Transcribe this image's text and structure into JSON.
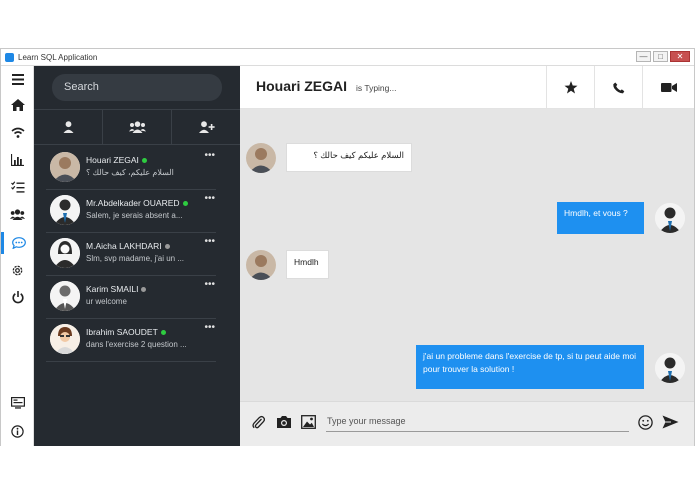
{
  "window": {
    "title": "Learn SQL Application",
    "controls": [
      "—",
      "□",
      "✕"
    ]
  },
  "rail": {
    "items": [
      "menu-icon",
      "home-icon",
      "wifi-icon",
      "stats-icon",
      "checklist-icon",
      "users-icon",
      "chat-icon",
      "settings-icon",
      "power-icon",
      "tv-icon",
      "info-icon"
    ],
    "active": "chat-icon"
  },
  "sidebar": {
    "search_placeholder": "Search",
    "tabs": [
      "person-icon",
      "group-icon",
      "add-person-icon"
    ],
    "contacts": [
      {
        "name": "Houari ZEGAI",
        "status": "online",
        "preview": "السلام عليكم، كيف حالك ؟",
        "more": "•••"
      },
      {
        "name": "Mr.Abdelkader OUARED",
        "status": "online",
        "preview": "Salem, je serais absent a...",
        "more": "•••"
      },
      {
        "name": "M.Aicha LAKHDARI",
        "status": "offline",
        "preview": "Slm, svp madame, j'ai un ...",
        "more": "•••"
      },
      {
        "name": "Karim SMAILI",
        "status": "offline",
        "preview": "ur welcome",
        "more": "•••"
      },
      {
        "name": "Ibrahim SAOUDET",
        "status": "online",
        "preview": "dans l'exercise 2 question ...",
        "more": "•••"
      }
    ]
  },
  "chat": {
    "name": "Houari ZEGAI",
    "status": "is Typing...",
    "header_actions": [
      "star-icon",
      "phone-icon",
      "video-icon"
    ],
    "messages": [
      {
        "side": "in",
        "text": "السلام عليكم كيف حالك ؟"
      },
      {
        "side": "out",
        "text": "Hmdlh, et vous ?"
      },
      {
        "side": "in",
        "text": "Hmdlh"
      },
      {
        "side": "out",
        "text": "j'ai un probleme dans l'exercise de tp, si tu peut aide moi pour trouver la solution !"
      }
    ]
  },
  "composer": {
    "placeholder": "Type your message",
    "icons": [
      "attach-icon",
      "camera-icon",
      "image-icon",
      "emoji-icon",
      "send-icon"
    ]
  },
  "colors": {
    "sidebar_bg": "#252a30",
    "accent": "#1e90f0",
    "online": "#2ecc40",
    "offline": "#9a9a9a"
  }
}
